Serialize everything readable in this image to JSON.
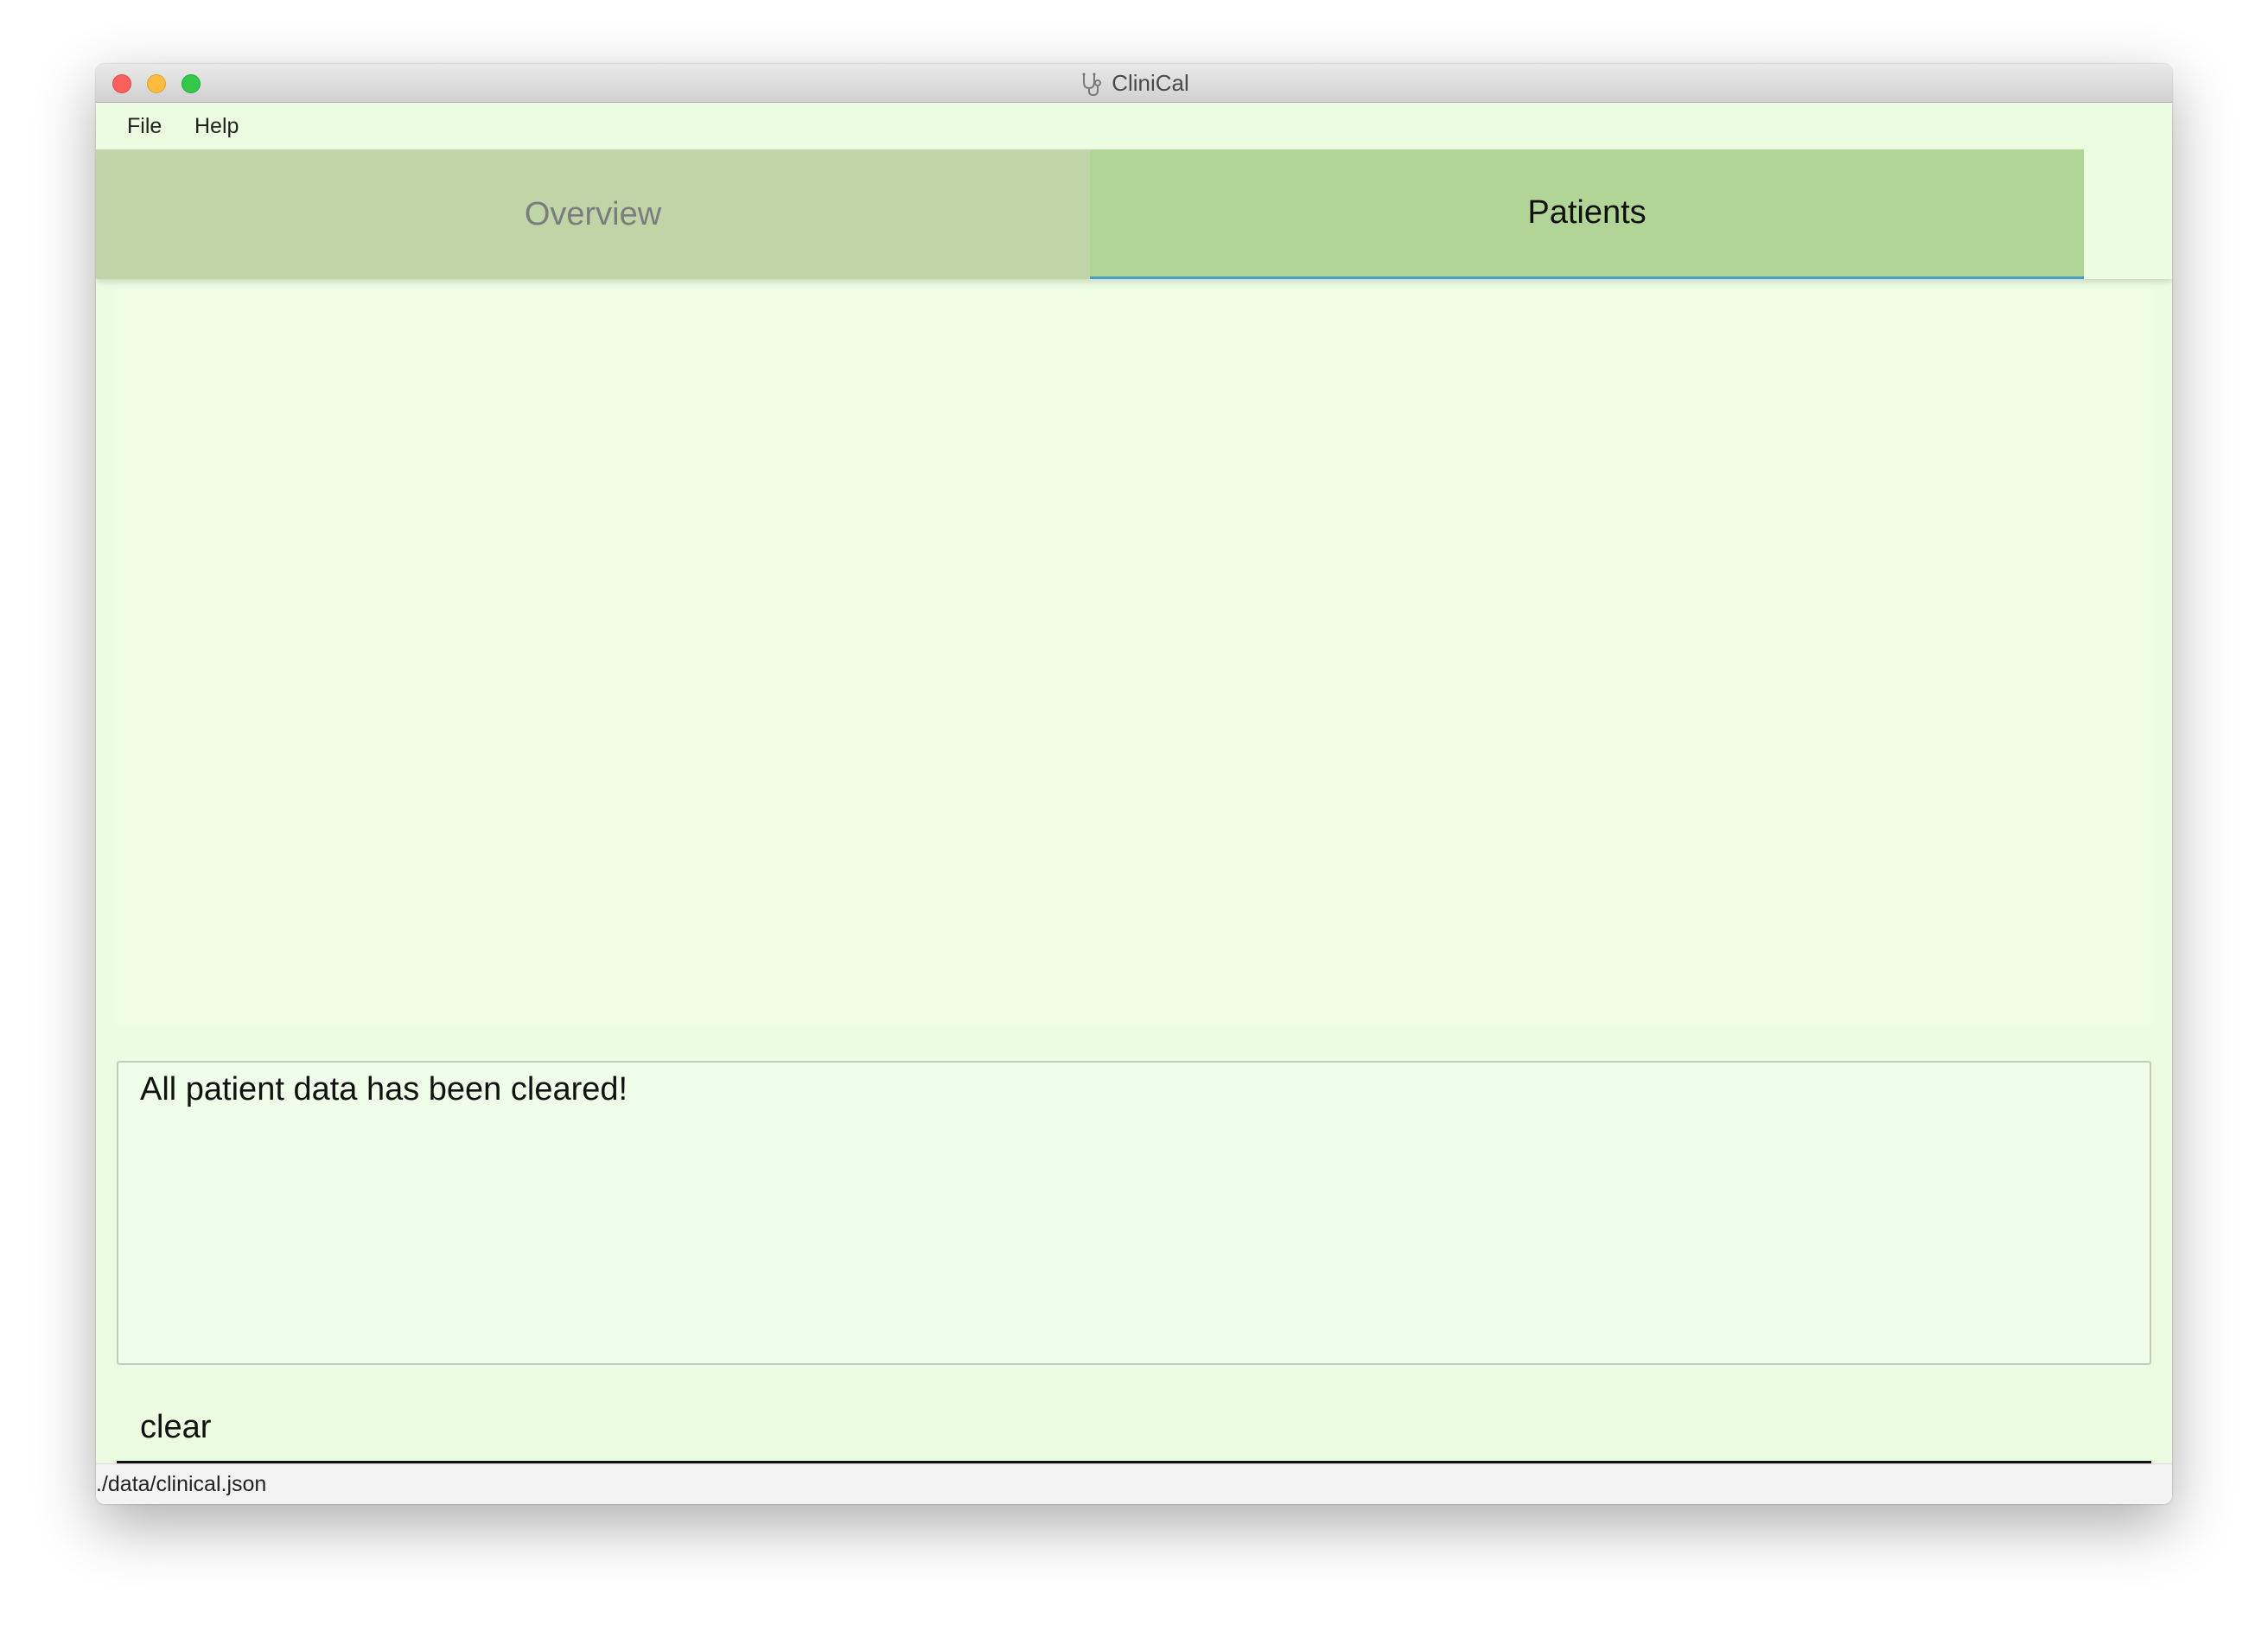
{
  "window": {
    "title": "CliniCal",
    "app_icon": "stethoscope-icon"
  },
  "menu": {
    "items": [
      {
        "label": "File"
      },
      {
        "label": "Help"
      }
    ]
  },
  "tabs": [
    {
      "label": "Overview",
      "selected": false
    },
    {
      "label": "Patients",
      "selected": true
    }
  ],
  "result": {
    "message": "All patient data has been cleared!"
  },
  "command": {
    "value": "clear"
  },
  "status": {
    "file_path": "./data/clinical.json"
  },
  "colors": {
    "window_bg": "#ecfce0",
    "tab_inactive_bg": "#c0d5a7",
    "tab_active_bg": "#b0d596",
    "tab_active_indicator": "#4a9dc9",
    "close_button": "#fc605c",
    "minimize_button": "#fdbc40",
    "zoom_button": "#34c84a"
  }
}
